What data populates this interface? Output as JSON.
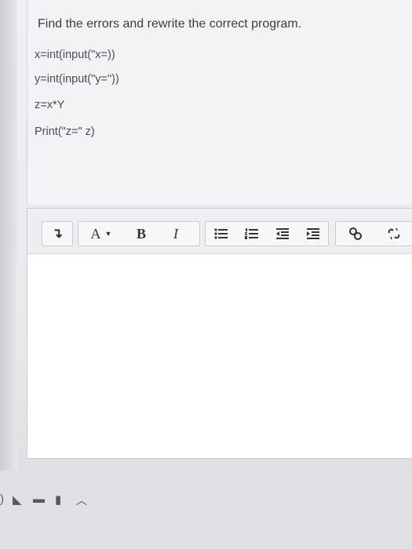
{
  "question": {
    "title": "Find the errors and rewrite the correct program.",
    "lines": [
      "x=int(input(\"x=))",
      "y=int(input(\"y=\"))",
      "z=x*Y",
      "Print(\"z=\" z)"
    ]
  },
  "toolbar": {
    "paragraph_glyph": "↴",
    "font_label": "A",
    "font_caret": "▼",
    "bold_label": "B",
    "italic_label": "I"
  },
  "colors": {
    "toolbar_bg": "#edeef0",
    "button_bg": "#f7f7f8",
    "page_bg": "#eef0f3"
  },
  "icons": {
    "unordered_list": "unordered-list-icon",
    "ordered_list": "ordered-list-icon",
    "outdent": "outdent-icon",
    "indent": "indent-icon",
    "link": "link-icon",
    "unlink": "unlink-icon"
  }
}
